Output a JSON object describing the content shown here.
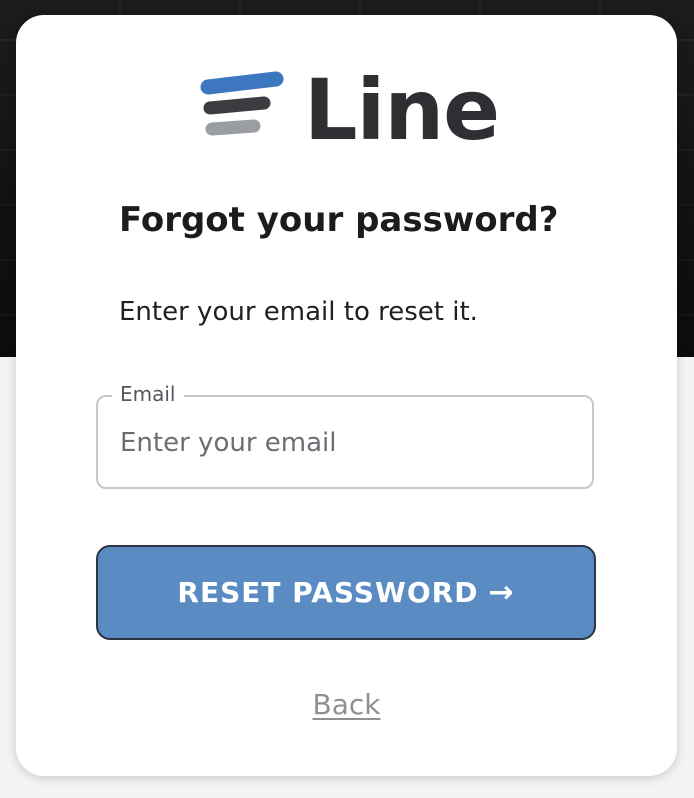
{
  "brand": {
    "name": "Line",
    "colors": {
      "bar_top": "#3d77c0",
      "bar_middle": "#3a3c40",
      "bar_bottom": "#9a9da2",
      "text": "#2d2f33"
    }
  },
  "form": {
    "title": "Forgot your password?",
    "subtitle": "Enter your email to reset it.",
    "email": {
      "label": "Email",
      "placeholder": "Enter your email",
      "value": ""
    },
    "submit": {
      "label": "RESET PASSWORD",
      "icon": "arrow-right-icon",
      "arrow": "→",
      "color": "#5b8bc3"
    },
    "back_link": "Back"
  }
}
